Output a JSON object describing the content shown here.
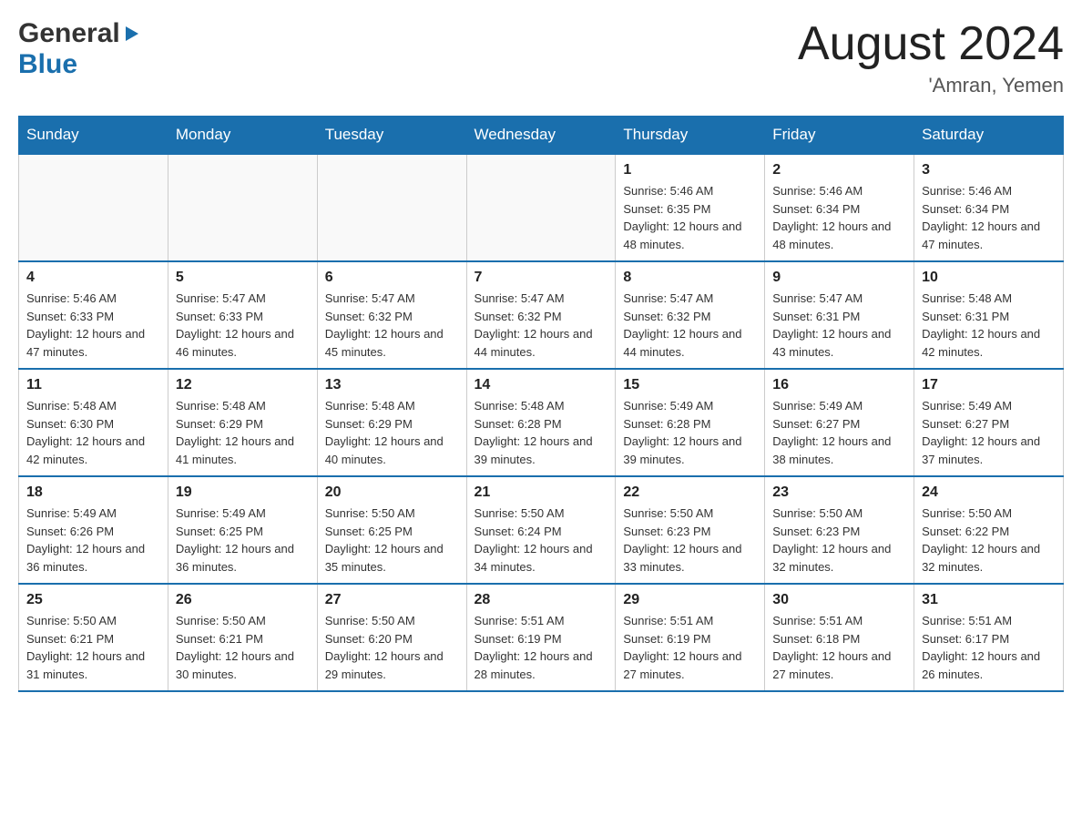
{
  "header": {
    "logo_general": "General",
    "logo_blue": "Blue",
    "month_title": "August 2024",
    "location": "'Amran, Yemen"
  },
  "days_of_week": [
    "Sunday",
    "Monday",
    "Tuesday",
    "Wednesday",
    "Thursday",
    "Friday",
    "Saturday"
  ],
  "weeks": [
    [
      {
        "day": "",
        "info": ""
      },
      {
        "day": "",
        "info": ""
      },
      {
        "day": "",
        "info": ""
      },
      {
        "day": "",
        "info": ""
      },
      {
        "day": "1",
        "info": "Sunrise: 5:46 AM\nSunset: 6:35 PM\nDaylight: 12 hours and 48 minutes."
      },
      {
        "day": "2",
        "info": "Sunrise: 5:46 AM\nSunset: 6:34 PM\nDaylight: 12 hours and 48 minutes."
      },
      {
        "day": "3",
        "info": "Sunrise: 5:46 AM\nSunset: 6:34 PM\nDaylight: 12 hours and 47 minutes."
      }
    ],
    [
      {
        "day": "4",
        "info": "Sunrise: 5:46 AM\nSunset: 6:33 PM\nDaylight: 12 hours and 47 minutes."
      },
      {
        "day": "5",
        "info": "Sunrise: 5:47 AM\nSunset: 6:33 PM\nDaylight: 12 hours and 46 minutes."
      },
      {
        "day": "6",
        "info": "Sunrise: 5:47 AM\nSunset: 6:32 PM\nDaylight: 12 hours and 45 minutes."
      },
      {
        "day": "7",
        "info": "Sunrise: 5:47 AM\nSunset: 6:32 PM\nDaylight: 12 hours and 44 minutes."
      },
      {
        "day": "8",
        "info": "Sunrise: 5:47 AM\nSunset: 6:32 PM\nDaylight: 12 hours and 44 minutes."
      },
      {
        "day": "9",
        "info": "Sunrise: 5:47 AM\nSunset: 6:31 PM\nDaylight: 12 hours and 43 minutes."
      },
      {
        "day": "10",
        "info": "Sunrise: 5:48 AM\nSunset: 6:31 PM\nDaylight: 12 hours and 42 minutes."
      }
    ],
    [
      {
        "day": "11",
        "info": "Sunrise: 5:48 AM\nSunset: 6:30 PM\nDaylight: 12 hours and 42 minutes."
      },
      {
        "day": "12",
        "info": "Sunrise: 5:48 AM\nSunset: 6:29 PM\nDaylight: 12 hours and 41 minutes."
      },
      {
        "day": "13",
        "info": "Sunrise: 5:48 AM\nSunset: 6:29 PM\nDaylight: 12 hours and 40 minutes."
      },
      {
        "day": "14",
        "info": "Sunrise: 5:48 AM\nSunset: 6:28 PM\nDaylight: 12 hours and 39 minutes."
      },
      {
        "day": "15",
        "info": "Sunrise: 5:49 AM\nSunset: 6:28 PM\nDaylight: 12 hours and 39 minutes."
      },
      {
        "day": "16",
        "info": "Sunrise: 5:49 AM\nSunset: 6:27 PM\nDaylight: 12 hours and 38 minutes."
      },
      {
        "day": "17",
        "info": "Sunrise: 5:49 AM\nSunset: 6:27 PM\nDaylight: 12 hours and 37 minutes."
      }
    ],
    [
      {
        "day": "18",
        "info": "Sunrise: 5:49 AM\nSunset: 6:26 PM\nDaylight: 12 hours and 36 minutes."
      },
      {
        "day": "19",
        "info": "Sunrise: 5:49 AM\nSunset: 6:25 PM\nDaylight: 12 hours and 36 minutes."
      },
      {
        "day": "20",
        "info": "Sunrise: 5:50 AM\nSunset: 6:25 PM\nDaylight: 12 hours and 35 minutes."
      },
      {
        "day": "21",
        "info": "Sunrise: 5:50 AM\nSunset: 6:24 PM\nDaylight: 12 hours and 34 minutes."
      },
      {
        "day": "22",
        "info": "Sunrise: 5:50 AM\nSunset: 6:23 PM\nDaylight: 12 hours and 33 minutes."
      },
      {
        "day": "23",
        "info": "Sunrise: 5:50 AM\nSunset: 6:23 PM\nDaylight: 12 hours and 32 minutes."
      },
      {
        "day": "24",
        "info": "Sunrise: 5:50 AM\nSunset: 6:22 PM\nDaylight: 12 hours and 32 minutes."
      }
    ],
    [
      {
        "day": "25",
        "info": "Sunrise: 5:50 AM\nSunset: 6:21 PM\nDaylight: 12 hours and 31 minutes."
      },
      {
        "day": "26",
        "info": "Sunrise: 5:50 AM\nSunset: 6:21 PM\nDaylight: 12 hours and 30 minutes."
      },
      {
        "day": "27",
        "info": "Sunrise: 5:50 AM\nSunset: 6:20 PM\nDaylight: 12 hours and 29 minutes."
      },
      {
        "day": "28",
        "info": "Sunrise: 5:51 AM\nSunset: 6:19 PM\nDaylight: 12 hours and 28 minutes."
      },
      {
        "day": "29",
        "info": "Sunrise: 5:51 AM\nSunset: 6:19 PM\nDaylight: 12 hours and 27 minutes."
      },
      {
        "day": "30",
        "info": "Sunrise: 5:51 AM\nSunset: 6:18 PM\nDaylight: 12 hours and 27 minutes."
      },
      {
        "day": "31",
        "info": "Sunrise: 5:51 AM\nSunset: 6:17 PM\nDaylight: 12 hours and 26 minutes."
      }
    ]
  ]
}
